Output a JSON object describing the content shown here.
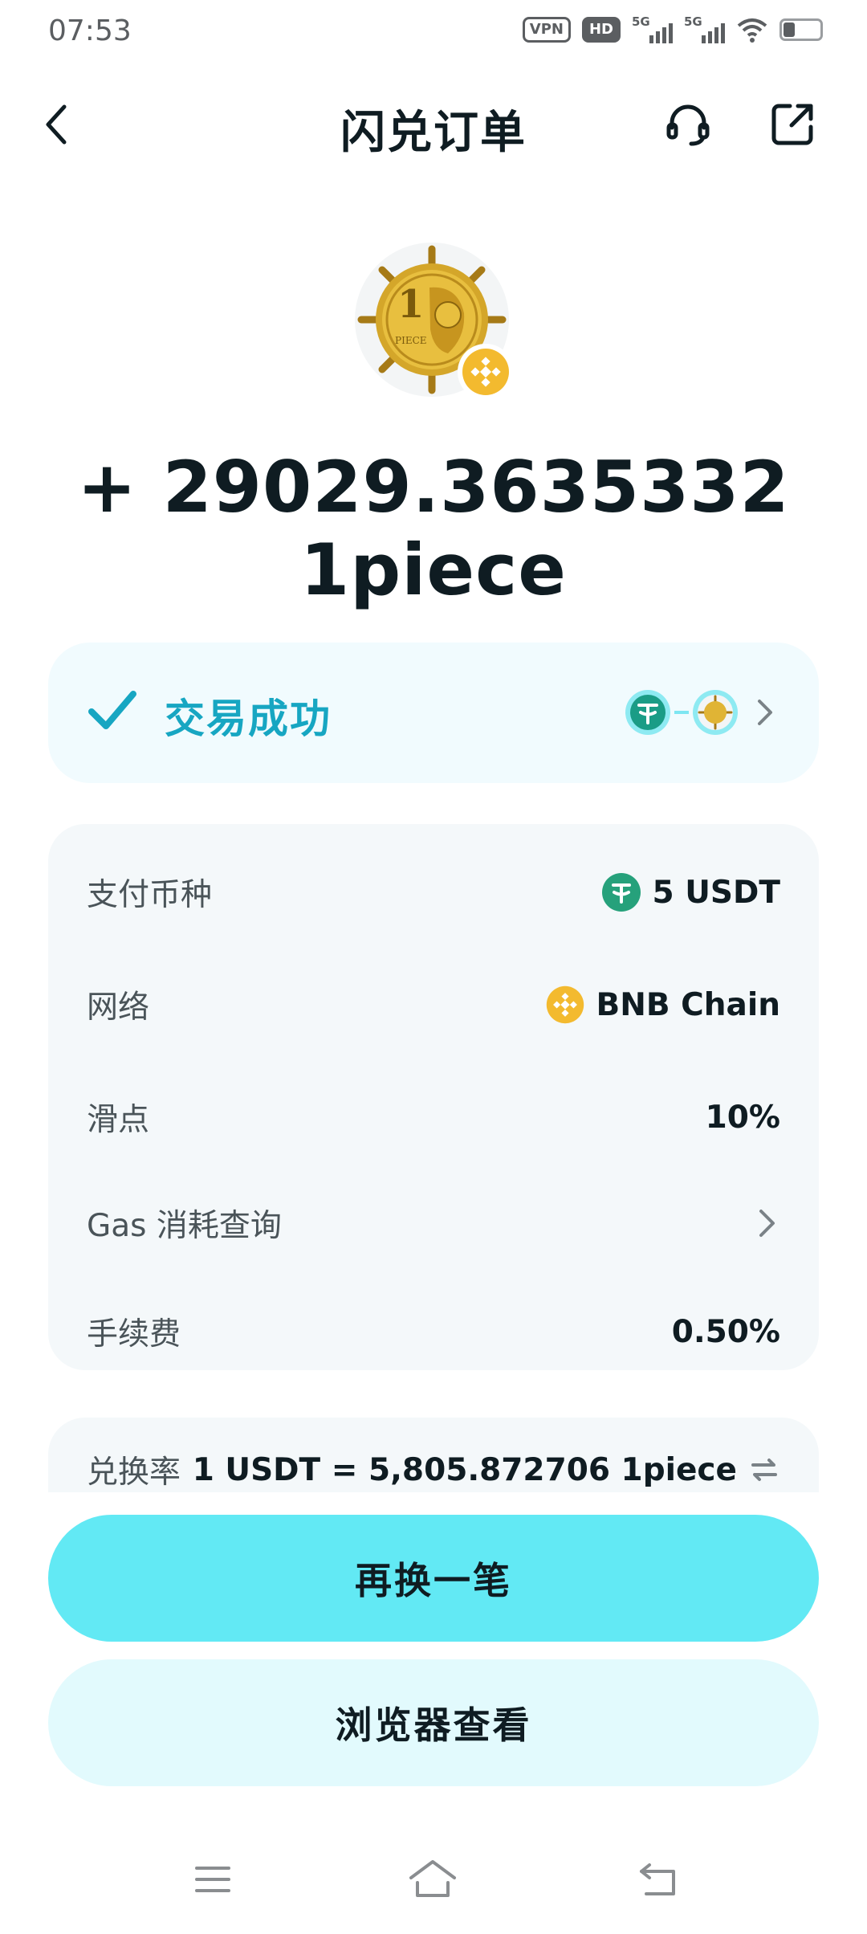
{
  "status_bar": {
    "time": "07:53",
    "vpn": "VPN",
    "hd": "HD",
    "sig1": "5G",
    "sig2": "5G",
    "icons": [
      "vpn-badge",
      "hd-badge",
      "signal-icon",
      "signal-icon",
      "wifi-icon",
      "battery-icon"
    ]
  },
  "header": {
    "title": "闪兑订单",
    "icons": [
      "back-arrow-icon",
      "headset-icon",
      "share-icon"
    ]
  },
  "token": {
    "logo_icon": "1piece-coin-logo",
    "chain_badge_icon": "bnb-icon"
  },
  "amount": "+ 29029.3635332 1piece",
  "status": {
    "text": "交易成功",
    "icon": "check-icon",
    "route_icons": [
      "usdt-icon",
      "1piece-icon",
      "chevron-right-icon"
    ]
  },
  "details": {
    "pay_currency_label": "支付币种",
    "pay_currency_value": "5 USDT",
    "network_label": "网络",
    "network_value": "BNB Chain",
    "slippage_label": "滑点",
    "slippage_value": "10%",
    "gas_label": "Gas 消耗查询",
    "fee_label": "手续费",
    "fee_value": "0.50%"
  },
  "rate": {
    "label": "兑换率",
    "value": "1 USDT = 5,805.872706 1piece"
  },
  "buttons": {
    "swap_again": "再换一笔",
    "view_browser": "浏览器查看"
  },
  "nav": {
    "icons": [
      "menu-icon",
      "home-icon",
      "back-icon"
    ]
  },
  "colors": {
    "accent": "#17a6c2",
    "primary_button": "#62e9f4",
    "secondary_button": "#e2fafd",
    "usdt": "#26a17b",
    "bnb": "#f3ba2f",
    "card_bg": "#f4f8fa"
  }
}
